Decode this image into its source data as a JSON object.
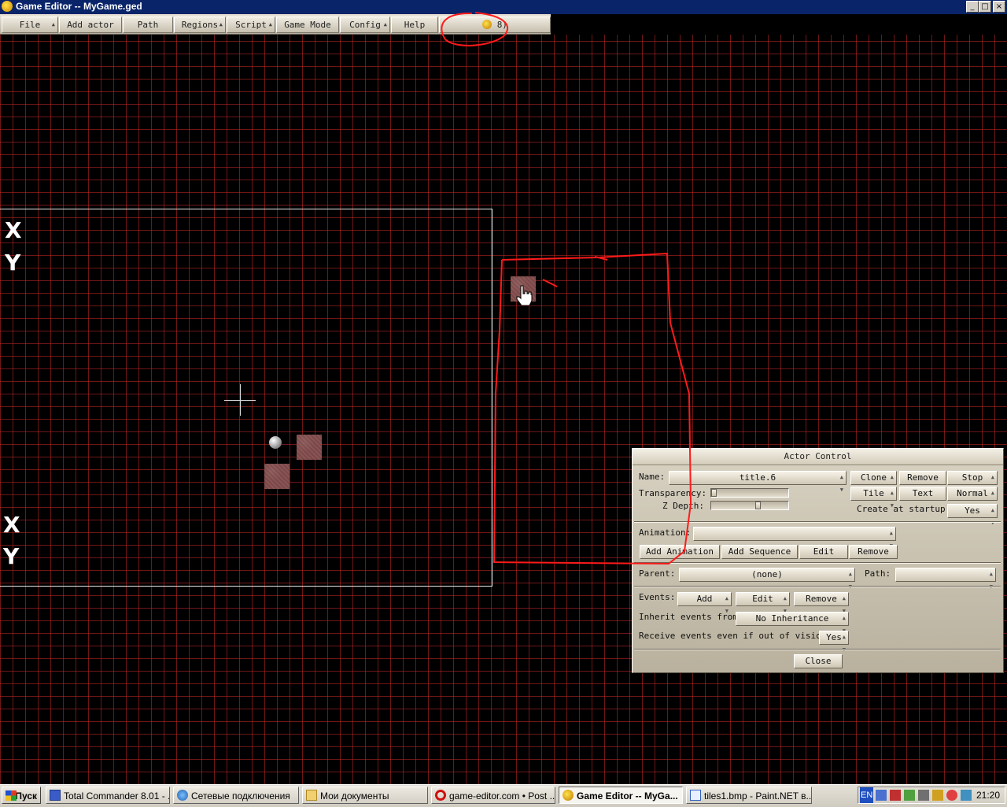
{
  "window": {
    "title": "Game Editor -- MyGame.ged",
    "minimize": "_",
    "maximize": "□",
    "close": "×"
  },
  "menu": {
    "items": [
      "File",
      "Add actor",
      "Path",
      "Regions",
      "Script",
      "Game Mode",
      "Config",
      "Help"
    ],
    "coords": "8)"
  },
  "canvas": {
    "x_label_top": "X",
    "y_label_top": "Y",
    "x_label_bottom": "X",
    "y_label_bottom": "Y"
  },
  "actor_control": {
    "title": "Actor Control",
    "name_label": "Name:",
    "name_value": "title.6",
    "clone": "Clone",
    "remove": "Remove",
    "stop": "Stop",
    "transparency_label": "Transparency:",
    "transparency_value": 0.0,
    "zdepth_label": "Z Depth:",
    "zdepth_value": 0.62,
    "tile": "Tile",
    "text": "Text",
    "normal": "Normal",
    "create_startup_label": "Create at startup:",
    "create_startup_value": "Yes",
    "animation_label": "Animation:",
    "animation_value": "",
    "add_animation": "Add Animation",
    "add_sequence": "Add Sequence",
    "edit_anim": "Edit",
    "remove_anim": "Remove",
    "parent_label": "Parent:",
    "parent_value": "(none)",
    "path_label": "Path:",
    "path_value": "",
    "events_label": "Events:",
    "events_add": "Add",
    "events_edit": "Edit",
    "events_remove": "Remove",
    "inherit_label": "Inherit events from:",
    "inherit_value": "No Inheritance",
    "receive_label": "Receive events even if out of vision:",
    "receive_value": "Yes",
    "close": "Close"
  },
  "taskbar": {
    "start": "Пуск",
    "tasks": [
      "Total Commander 8.01 - ...",
      "Сетевые подключения",
      "Мои документы",
      "game-editor.com • Post ...",
      "Game Editor -- MyGa...",
      "tiles1.bmp - Paint.NET в..."
    ],
    "lang": "EN",
    "clock": "21:20"
  },
  "colors": {
    "titlebar": "#0a246a",
    "grid": "#c82828",
    "annotation": "#ff1a1a",
    "panel": "#d0c9b8"
  }
}
